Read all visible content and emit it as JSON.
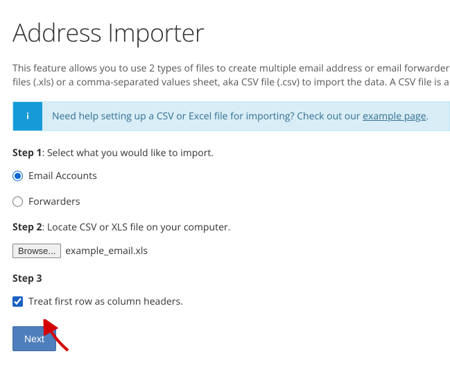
{
  "title": "Address Importer",
  "intro_line1": "This feature allows you to use 2 types of files to create multiple email address or email forwarders",
  "intro_line2": "files (.xls) or a comma-separated values sheet, aka CSV file (.csv) to import the data. A CSV file is a",
  "alert": {
    "text_before": "Need help setting up a CSV or Excel file for importing? Check out our ",
    "link_text": "example page",
    "text_after": "."
  },
  "step1": {
    "label_bold": "Step 1",
    "label_rest": ": Select what you would like to import.",
    "option_email": "Email Accounts",
    "option_forwarders": "Forwarders"
  },
  "step2": {
    "label_bold": "Step 2",
    "label_rest": ": Locate CSV or XLS file on your computer.",
    "browse_label": "Browse...",
    "filename": "example_email.xls"
  },
  "step3": {
    "label": "Step 3",
    "checkbox_label": "Treat first row as column headers."
  },
  "next_label": "Next"
}
